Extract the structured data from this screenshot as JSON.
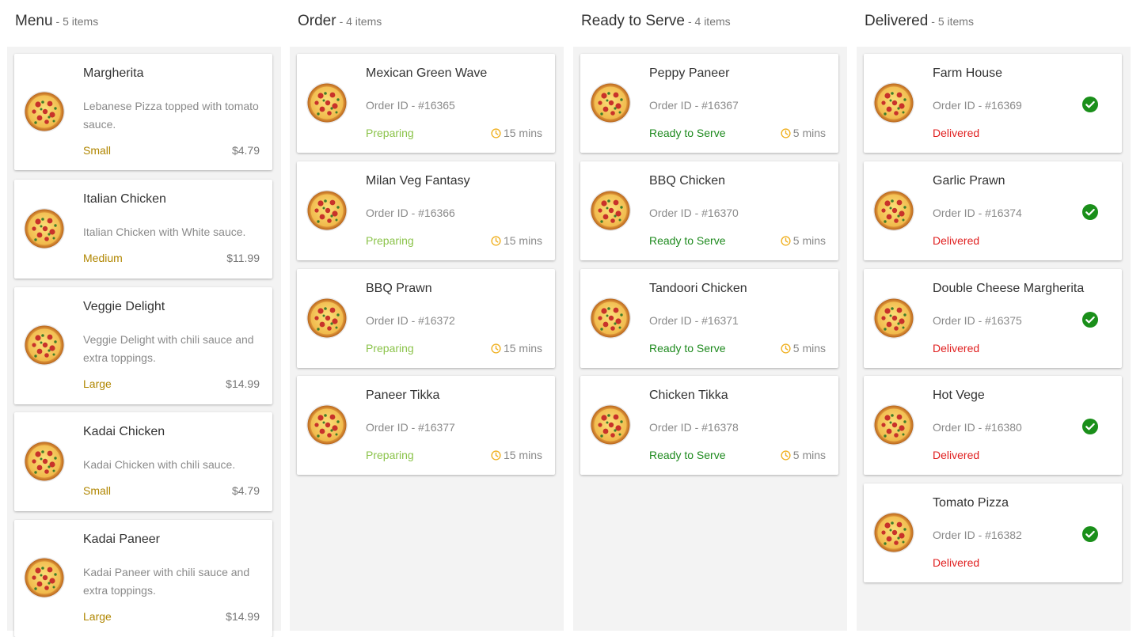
{
  "colors": {
    "size": "#b08600",
    "preparing": "#8bc34a",
    "ready": "#1e8a1e",
    "delivered": "#e02020",
    "clock": "#f0b020",
    "check": "#1a8f1a"
  },
  "columns": {
    "menu": {
      "title": "Menu",
      "count": "- 5 items",
      "items": [
        {
          "name": "Margherita",
          "desc": "Lebanese Pizza topped with tomato sauce.",
          "size": "Small",
          "price": "$4.79"
        },
        {
          "name": "Italian Chicken",
          "desc": "Italian Chicken with White sauce.",
          "size": "Medium",
          "price": "$11.99"
        },
        {
          "name": "Veggie Delight",
          "desc": "Veggie Delight with chili sauce and extra toppings.",
          "size": "Large",
          "price": "$14.99"
        },
        {
          "name": "Kadai Chicken",
          "desc": "Kadai Chicken with chili sauce.",
          "size": "Small",
          "price": "$4.79"
        },
        {
          "name": "Kadai Paneer",
          "desc": "Kadai Paneer with chili sauce and extra toppings.",
          "size": "Large",
          "price": "$14.99"
        }
      ]
    },
    "order": {
      "title": "Order",
      "count": "- 4 items",
      "items": [
        {
          "name": "Mexican Green Wave",
          "order_id": "Order ID - #16365",
          "status": "Preparing",
          "time": "15 mins"
        },
        {
          "name": "Milan Veg Fantasy",
          "order_id": "Order ID - #16366",
          "status": "Preparing",
          "time": "15 mins"
        },
        {
          "name": "BBQ Prawn",
          "order_id": "Order ID - #16372",
          "status": "Preparing",
          "time": "15 mins"
        },
        {
          "name": "Paneer Tikka",
          "order_id": "Order ID - #16377",
          "status": "Preparing",
          "time": "15 mins"
        }
      ]
    },
    "ready": {
      "title": "Ready to Serve",
      "count": "- 4 items",
      "items": [
        {
          "name": "Peppy Paneer",
          "order_id": "Order ID - #16367",
          "status": "Ready to Serve",
          "time": "5 mins"
        },
        {
          "name": "BBQ Chicken",
          "order_id": "Order ID - #16370",
          "status": "Ready to Serve",
          "time": "5 mins"
        },
        {
          "name": "Tandoori Chicken",
          "order_id": "Order ID - #16371",
          "status": "Ready to Serve",
          "time": "5 mins"
        },
        {
          "name": "Chicken Tikka",
          "order_id": "Order ID - #16378",
          "status": "Ready to Serve",
          "time": "5 mins"
        }
      ]
    },
    "delivered": {
      "title": "Delivered",
      "count": "- 5 items",
      "items": [
        {
          "name": "Farm House",
          "order_id": "Order ID - #16369",
          "status": "Delivered"
        },
        {
          "name": "Garlic Prawn",
          "order_id": "Order ID - #16374",
          "status": "Delivered"
        },
        {
          "name": "Double Cheese Margherita",
          "order_id": "Order ID - #16375",
          "status": "Delivered"
        },
        {
          "name": "Hot Vege",
          "order_id": "Order ID - #16380",
          "status": "Delivered"
        },
        {
          "name": "Tomato Pizza",
          "order_id": "Order ID - #16382",
          "status": "Delivered"
        }
      ]
    }
  },
  "icons": {
    "pizza": "pizza-icon",
    "clock": "clock-icon",
    "check": "check-circle-icon"
  }
}
